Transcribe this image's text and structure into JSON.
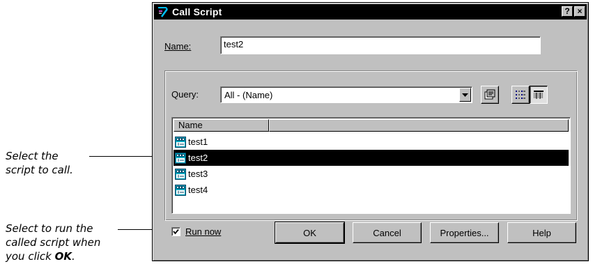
{
  "callouts": {
    "select_script_line1": "Select the",
    "select_script_line2": "script to call.",
    "run_now_line1": "Select to run the",
    "run_now_line2": "called script when",
    "run_now_line3_prefix": "you click ",
    "run_now_line3_bold": "OK",
    "run_now_line3_suffix": "."
  },
  "dialog": {
    "title": "Call Script",
    "help_glyph": "?",
    "close_glyph": "×",
    "name_label": "Name:",
    "name_value": "test2",
    "query_label": "Query:",
    "query_value": "All - (Name)",
    "list_header": "Name",
    "items": [
      "test1",
      "test2",
      "test3",
      "test4"
    ],
    "selected_item": "test2",
    "run_now_label": "Run now",
    "run_now_checked": true,
    "buttons": {
      "ok": "OK",
      "cancel": "Cancel",
      "properties": "Properties...",
      "help": "Help"
    }
  },
  "colors": {
    "dialog_face": "#c0c0c0",
    "titlebar": "#000000",
    "selection": "#000000",
    "gui_icon": "#00a8c0"
  }
}
